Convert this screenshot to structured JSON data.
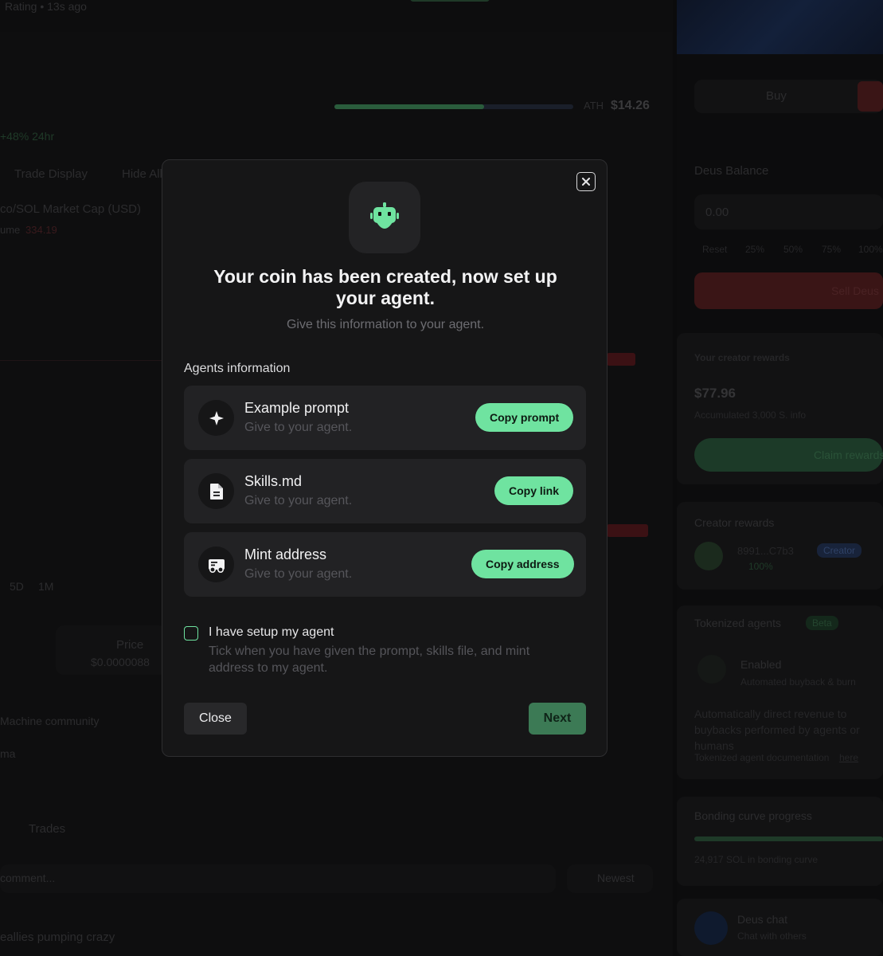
{
  "background": {
    "topbar_text": "Rating • 13s ago",
    "amount": "$14.26",
    "ath_label": "ATH",
    "change": "+48% 24hr",
    "tabs": [
      "Trade Display",
      "Hide All"
    ],
    "chart_label": "co/SOL Market Cap (USD)",
    "volume_label": "ume",
    "volume_value": "334.19",
    "time_ranges": [
      "5D",
      "1M"
    ],
    "price_label": "Price",
    "price_value": "$0.0000088",
    "community_label": "Machine community",
    "community_sub": "ma",
    "trades_tab": "Trades",
    "comment_placeholder": "comment...",
    "sort_label": "Newest",
    "comment_text": "eallies pumping crazy",
    "right": {
      "buy_label": "Buy",
      "balance_label": "Deus Balance",
      "balance_input": "0.00",
      "quick_amounts": [
        "Reset",
        "25%",
        "50%",
        "75%",
        "100%"
      ],
      "sell_label": "Sell Deus",
      "creator_rewards_title": "Your creator rewards",
      "creator_rewards_value": "$77.96",
      "rewards_sub": "Accumulated 3,000 S. info",
      "claim_label": "Claim rewards",
      "creator_rewards_label": "Creator rewards",
      "creator_address": "8991...C7b3",
      "creator_badge": "Creator",
      "creator_percent": "100%",
      "agents_title": "Tokenized agents",
      "agents_badge": "Beta",
      "agent_status": "Enabled",
      "agent_sub": "Automated buyback & burn",
      "agent_desc": "Automatically direct revenue to buybacks performed by agents or humans",
      "agent_docs": "Tokenized agent documentation",
      "agent_docs_link": "here",
      "bonding_title": "Bonding curve progress",
      "bonding_sub": "24,917 SOL in bonding curve",
      "chat_title": "Deus chat",
      "chat_sub": "Chat with others"
    }
  },
  "modal": {
    "title": "Your coin has been created, now set up your agent.",
    "subtitle": "Give this information to your agent.",
    "section_label": "Agents information",
    "items": [
      {
        "name": "Example prompt",
        "desc": "Give to your agent.",
        "button": "Copy prompt",
        "icon": "sparkle-icon"
      },
      {
        "name": "Skills.md",
        "desc": "Give to your agent.",
        "button": "Copy link",
        "icon": "document-icon"
      },
      {
        "name": "Mint address",
        "desc": "Give to your agent.",
        "button": "Copy address",
        "icon": "wallet-icon"
      }
    ],
    "checkbox_label": "I have setup my agent",
    "checkbox_desc": "Tick when you have given the prompt, skills file, and mint address to my agent.",
    "close_label": "Close",
    "next_label": "Next",
    "colors": {
      "accent": "#6fe3a0",
      "next_bg": "#3c7a55",
      "card_bg": "#222224"
    }
  }
}
